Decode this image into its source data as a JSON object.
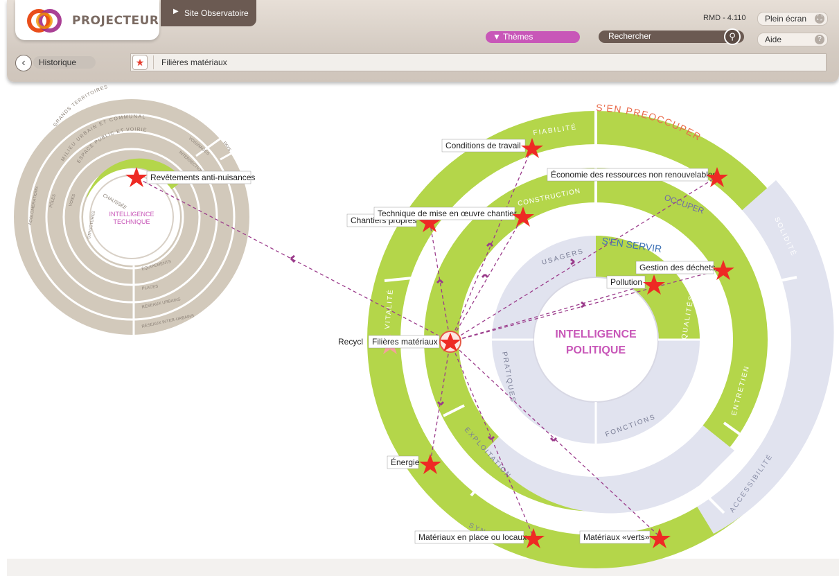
{
  "header": {
    "logo_text": "PROJECTEUR",
    "site_tab": "Site Observatoire",
    "version": "RMD - 4.110",
    "fullscreen_label": "Plein écran",
    "help_label": "Aide",
    "themes_label": "Thèmes",
    "search_placeholder": "Rechercher"
  },
  "nav": {
    "history_label": "Historique",
    "breadcrumb_current": "Filières matériaux"
  },
  "left_wheel": {
    "center_line1": "INTELLIGENCE",
    "center_line2": "TECHNIQUE",
    "ring_labels": [
      "AGGLOMÉRATIONS",
      "PÔLES",
      "VOIES",
      "STRUCTURES",
      "GRANDS TERRITOIRES",
      "MILIEU URBAIN ET COMMUNAL",
      "ESPACE PUBLIC ET VOIRIE",
      "CHAUSSÉE",
      "VOISINAGES",
      "INTERSECTIONS",
      "PAYS",
      "ÉQUIPEMENTS",
      "PLACES",
      "RÉSEAUX URBAINS",
      "RÉSEAUX INTER-URBAINS"
    ],
    "callout": "Revêtements anti-nuisances"
  },
  "right_wheel": {
    "center_line1": "INTELLIGENCE",
    "center_line2": "POLITIQUE",
    "outer_title": "S'EN PREOCCUPER",
    "middle_title": "OCCUPER",
    "inner_title": "S'EN SERVIR",
    "segment_labels": {
      "fiabilite": "FIABILITÉ",
      "solidite": "SOLIDITÉ",
      "vitalite": "VITALITÉ",
      "accessibilite": "ACCESSIBILITÉ",
      "construction": "CONSTRUCTION",
      "entretien": "ENTRETIEN",
      "exploitation": "EXPLOITATION",
      "usagers": "USAGERS",
      "qualites": "QUALITÉS",
      "pratiques": "PRATIQUES",
      "fonctions": "FONCTIONS"
    },
    "hub_label": "Filières matériaux",
    "hub_partial": "Recycl",
    "callouts": {
      "conditions": "Conditions de travail",
      "economie": "Économie des ressources non renouvelables",
      "technique": "Technique de mise en œuvre chantier",
      "chantiers": "Chantiers propres",
      "gestion": "Gestion des déchets",
      "pollution": "Pollution",
      "energie": "Énergie",
      "materiaux_place": "Matériaux en place ou locaux",
      "materiaux_verts": "Matériaux «verts»",
      "synthese_partial": "SYN"
    }
  },
  "colors": {
    "green": "#b4d64a",
    "taupe": "#d2c9bb",
    "lavender": "#e1e3ef",
    "pink": "#c857b8",
    "red_star": "#ee2a24",
    "dash": "#9b3b8b"
  }
}
